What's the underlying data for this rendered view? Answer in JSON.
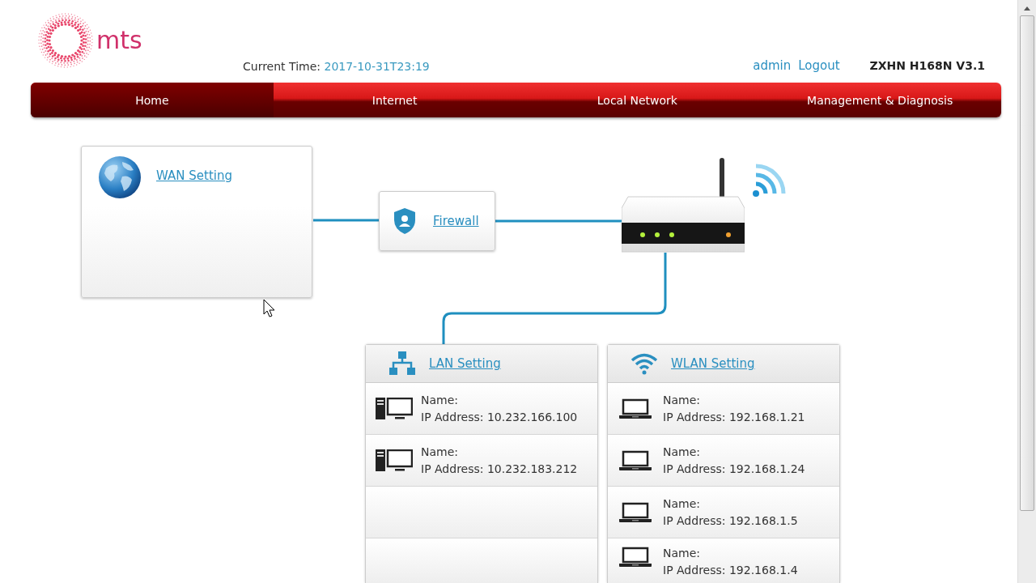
{
  "header": {
    "logo_text": "mts",
    "current_time_label": "Current Time:",
    "current_time": "2017-10-31T23:19",
    "user": "admin",
    "logout": "Logout",
    "model": "ZXHN H168N V3.1"
  },
  "nav_tabs": [
    {
      "label": "Home",
      "selected": true
    },
    {
      "label": "Internet",
      "selected": false
    },
    {
      "label": "Local Network",
      "selected": false
    },
    {
      "label": "Management & Diagnosis",
      "selected": false
    }
  ],
  "diagram": {
    "wan": {
      "label": "WAN Setting"
    },
    "firewall": {
      "label": "Firewall"
    },
    "lan": {
      "label": "LAN Setting",
      "devices": [
        {
          "name_label": "Name:",
          "ip": "IP Address: 10.232.166.100"
        },
        {
          "name_label": "Name:",
          "ip": "IP Address: 10.232.183.212"
        }
      ]
    },
    "wlan": {
      "label": "WLAN Setting",
      "devices": [
        {
          "name_label": "Name:",
          "ip": "IP Address: 192.168.1.21"
        },
        {
          "name_label": "Name:",
          "ip": "IP Address: 192.168.1.24"
        },
        {
          "name_label": "Name:",
          "ip": "IP Address: 192.168.1.5"
        },
        {
          "name_label": "Name:",
          "ip": "IP Address: 192.168.1.4"
        }
      ]
    }
  }
}
